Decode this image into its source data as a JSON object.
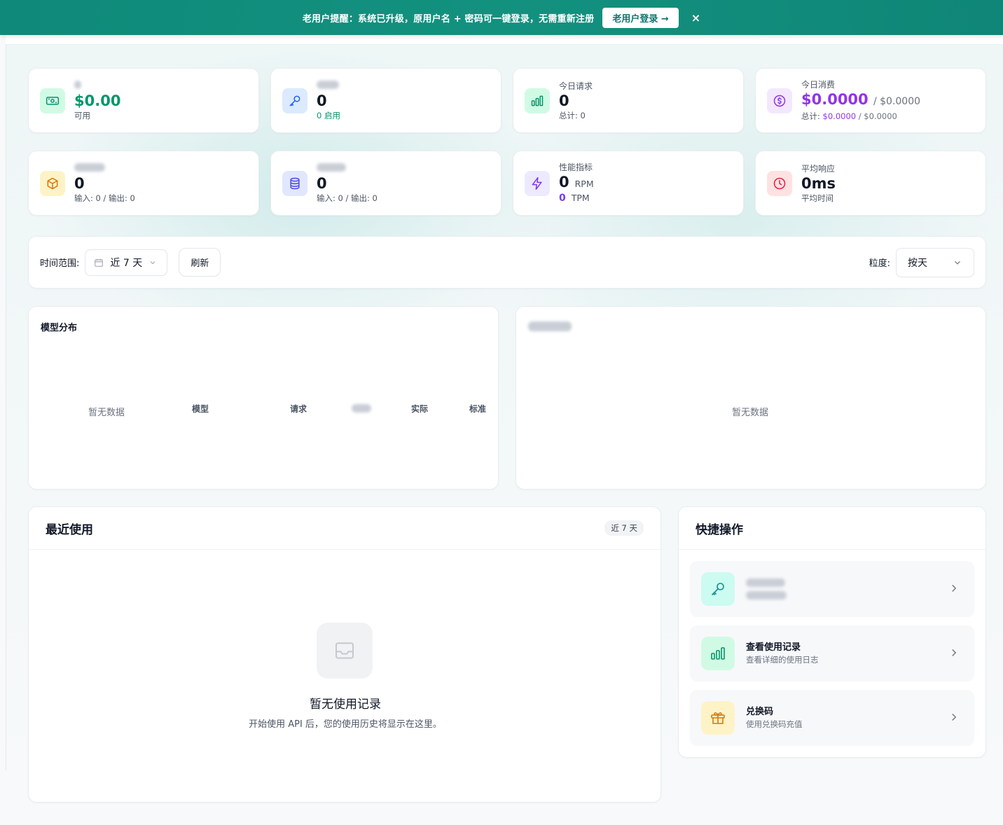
{
  "banner": {
    "text": "老用户提醒：系统已升级，原用户名 + 密码可一键登录，无需重新注册",
    "button": "老用户登录 →",
    "close": "×"
  },
  "stats": {
    "balance": {
      "value": "$0.00",
      "sub": "可用",
      "icon": "money-icon",
      "color": "#059669"
    },
    "keys": {
      "value": "0",
      "sub": "0 启用",
      "icon": "key-icon"
    },
    "requests": {
      "label": "今日请求",
      "value": "0",
      "sub": "总计: 0",
      "icon": "bar-chart-icon"
    },
    "cost": {
      "label": "今日消费",
      "value": "$0.0000",
      "value2": "/ $0.0000",
      "sub_prefix": "总计:",
      "sub_value": "$0.0000",
      "sub_value2": "/ $0.0000",
      "icon": "dollar-icon"
    },
    "tokens": {
      "value": "0",
      "sub": "输入: 0 / 输出: 0",
      "icon": "cube-icon"
    },
    "total_tokens": {
      "value": "0",
      "sub": "输入: 0 / 输出: 0",
      "icon": "database-icon"
    },
    "performance": {
      "label": "性能指标",
      "rpm_value": "0",
      "rpm_unit": "RPM",
      "tpm_value": "0",
      "tpm_unit": "TPM",
      "icon": "bolt-icon"
    },
    "latency": {
      "label": "平均响应",
      "value": "0ms",
      "sub": "平均时间",
      "icon": "clock-icon"
    }
  },
  "filters": {
    "range_label": "时间范围:",
    "range_value": "近 7 天",
    "refresh": "刷新",
    "granularity_label": "粒度:",
    "granularity_value": "按天"
  },
  "model_distribution": {
    "title": "模型分布",
    "empty": "暂无数据",
    "columns": [
      "模型",
      "请求",
      "实际",
      "标准"
    ]
  },
  "trend": {
    "empty": "暂无数据"
  },
  "recent": {
    "title": "最近使用",
    "badge": "近 7 天",
    "empty_title": "暂无使用记录",
    "empty_desc": "开始使用 API 后，您的使用历史将显示在这里。"
  },
  "quick_actions": {
    "title": "快捷操作",
    "items": [
      {
        "icon": "key-icon"
      },
      {
        "title": "查看使用记录",
        "desc": "查看详细的使用日志",
        "icon": "bar-chart-icon"
      },
      {
        "title": "兑换码",
        "desc": "使用兑换码充值",
        "icon": "gift-icon"
      }
    ]
  },
  "colors": {
    "brand": "#0f8a7a",
    "green": "#059669",
    "purple": "#9333ea"
  }
}
